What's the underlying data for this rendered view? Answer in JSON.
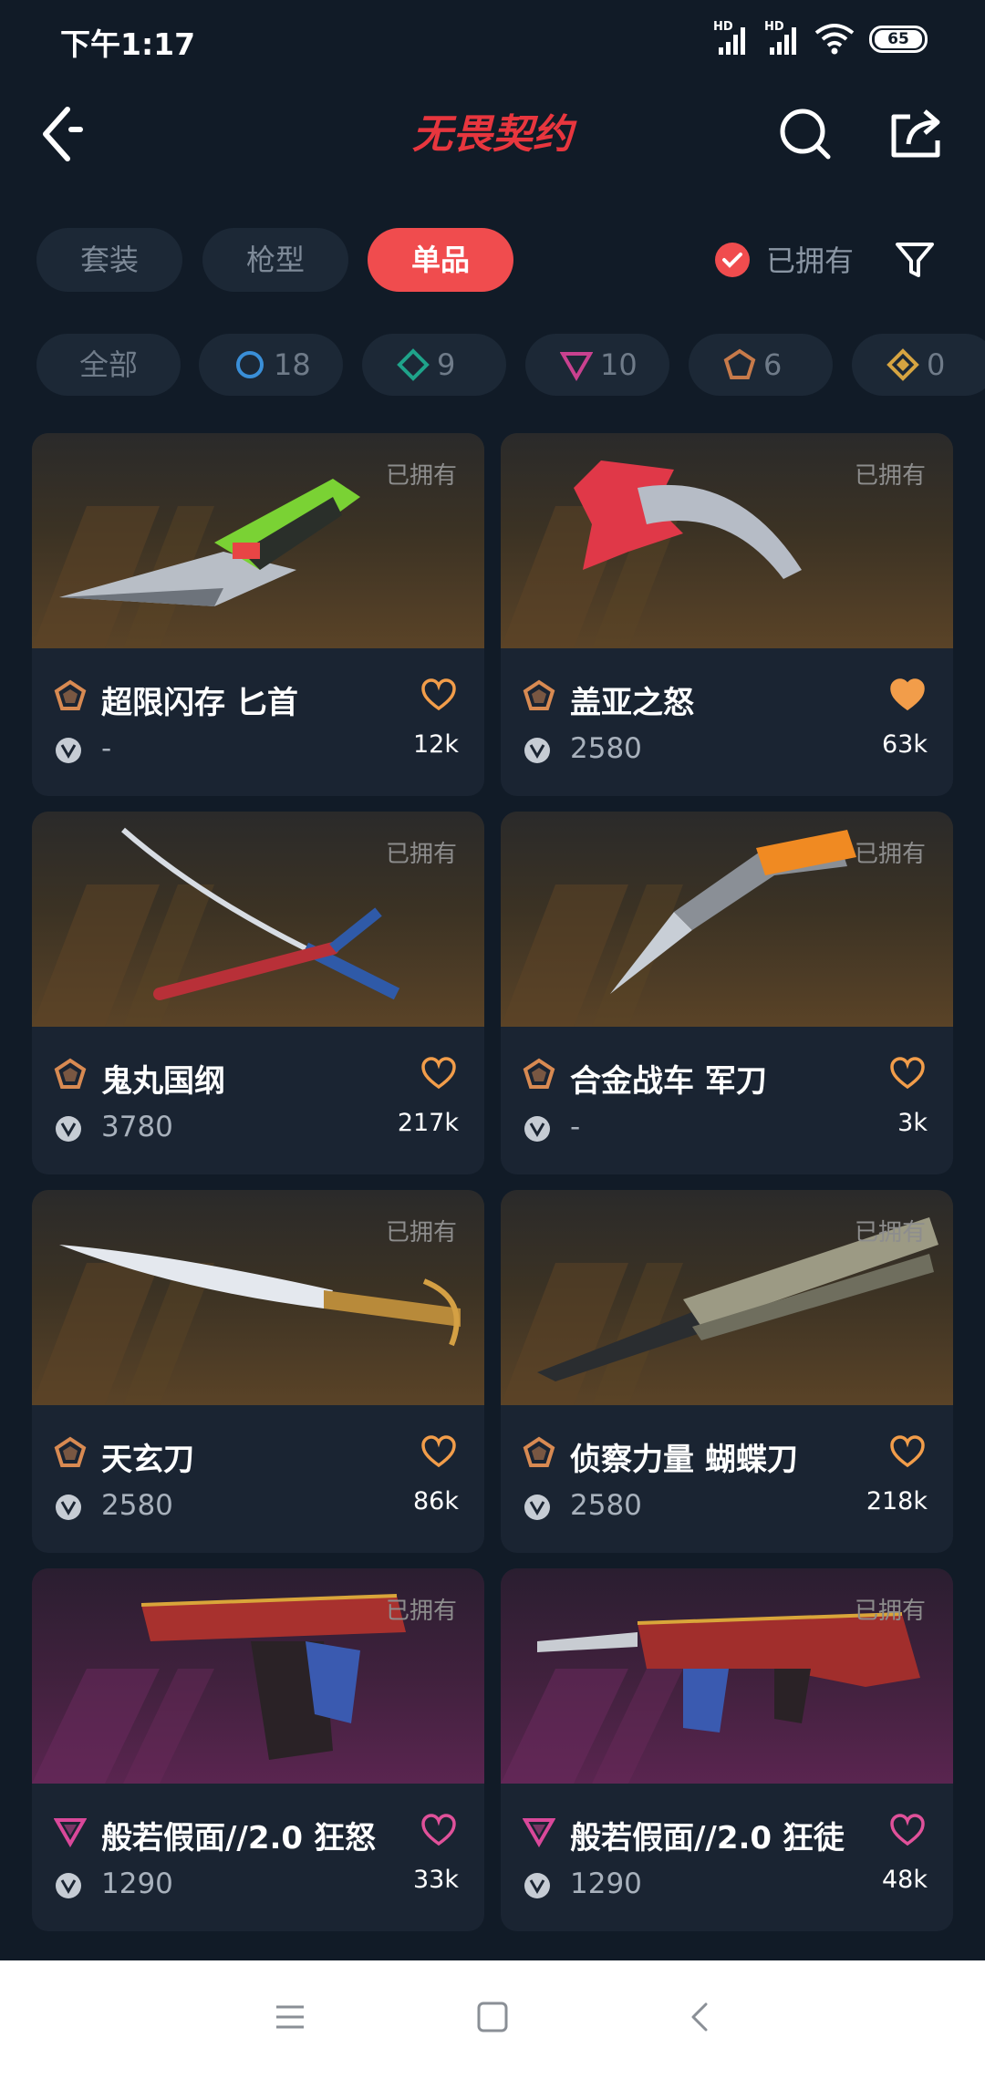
{
  "status_bar": {
    "time": "下午1:17",
    "signal_1_label": "HD",
    "signal_2_label": "HD",
    "battery": "65"
  },
  "header": {
    "title": "无畏契约",
    "title_color": "#e8363e",
    "icons": [
      "back-icon",
      "search-icon",
      "share-icon"
    ]
  },
  "tabs": [
    {
      "label": "套装",
      "active": false
    },
    {
      "label": "枪型",
      "active": false
    },
    {
      "label": "单品",
      "active": true
    }
  ],
  "owned_filter": {
    "label": "已拥有",
    "checked": true
  },
  "rarity_chips": [
    {
      "label": "全部"
    },
    {
      "icon": "select-tier-icon",
      "count": "18",
      "color": "#3a8fd8"
    },
    {
      "icon": "deluxe-tier-icon",
      "count": "9",
      "color": "#1fa38a"
    },
    {
      "icon": "premium-tier-icon",
      "count": "10",
      "color": "#c9418f"
    },
    {
      "icon": "exclusive-tier-icon",
      "count": "6",
      "color": "#c77a4a"
    },
    {
      "icon": "ultra-tier-icon",
      "count": "0",
      "color": "#d6a441"
    }
  ],
  "items": [
    {
      "name": "超限闪存 匕首",
      "price": "-",
      "likes": "12k",
      "owned_label": "已拥有",
      "liked": false,
      "tier": "exclusive"
    },
    {
      "name": "盖亚之怒",
      "price": "2580",
      "likes": "63k",
      "owned_label": "已拥有",
      "liked": true,
      "tier": "exclusive"
    },
    {
      "name": "鬼丸国纲",
      "price": "3780",
      "likes": "217k",
      "owned_label": "已拥有",
      "liked": false,
      "tier": "exclusive"
    },
    {
      "name": "合金战车 军刀",
      "price": "-",
      "likes": "3k",
      "owned_label": "已拥有",
      "liked": false,
      "tier": "exclusive"
    },
    {
      "name": "天玄刀",
      "price": "2580",
      "likes": "86k",
      "owned_label": "已拥有",
      "liked": false,
      "tier": "exclusive"
    },
    {
      "name": "侦察力量 蝴蝶刀",
      "price": "2580",
      "likes": "218k",
      "owned_label": "已拥有",
      "liked": false,
      "tier": "exclusive"
    },
    {
      "name": "般若假面//2.0 狂怒",
      "price": "1290",
      "likes": "33k",
      "owned_label": "已拥有",
      "liked": false,
      "tier": "premium"
    },
    {
      "name": "般若假面//2.0 狂徒",
      "price": "1290",
      "likes": "48k",
      "owned_label": "已拥有",
      "liked": false,
      "tier": "premium"
    }
  ],
  "colors": {
    "accent": "#f04c4e",
    "exclusive_tier": "#d88a52",
    "premium_tier": "#d9489a",
    "like_exclusive": "#f29d4a",
    "like_premium": "#e0519a"
  },
  "system_nav": [
    "menu-icon",
    "home-icon",
    "back-nav-icon"
  ]
}
